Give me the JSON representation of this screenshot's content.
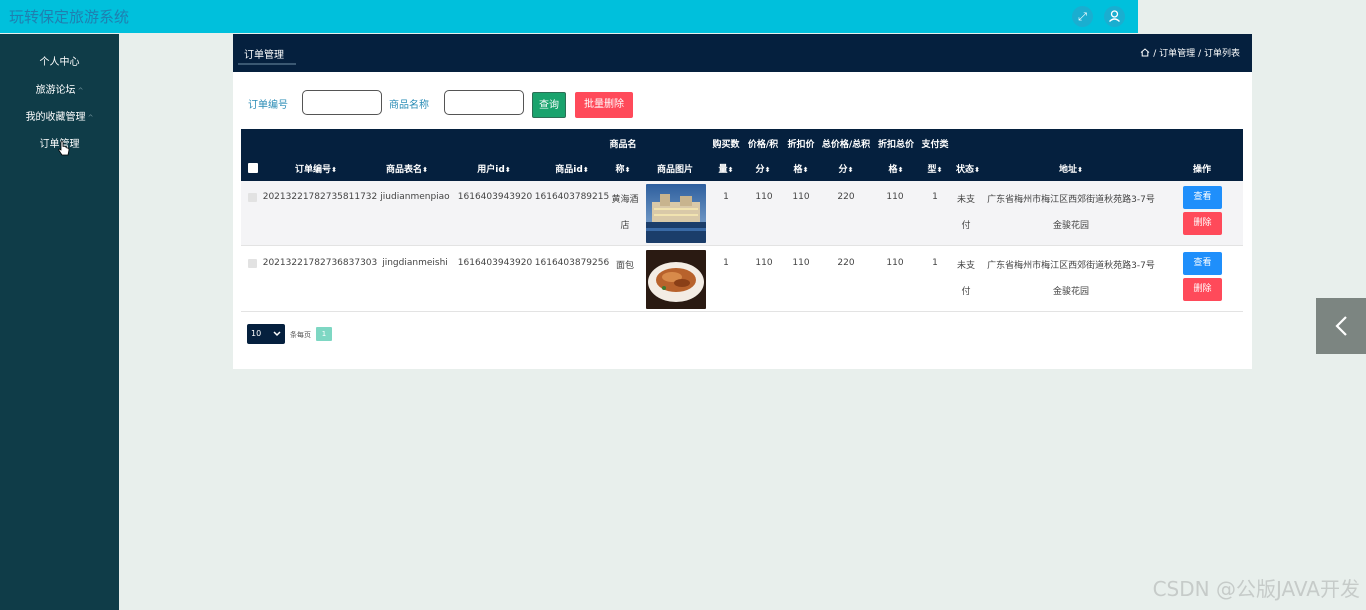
{
  "app": {
    "title": "玩转保定旅游系统"
  },
  "topbar": {
    "fullscreen_icon": "⤢",
    "user_icon": "👤"
  },
  "sidebar": {
    "items": [
      {
        "label": "个人中心",
        "caret": ""
      },
      {
        "label": "旅游论坛",
        "caret": "^"
      },
      {
        "label": "我的收藏管理",
        "caret": "^"
      },
      {
        "label": "订单管理",
        "caret": ""
      }
    ]
  },
  "panel": {
    "tab": "订单管理",
    "breadcrumb": {
      "current": "订单管理",
      "sub": "订单列表",
      "sep": "/"
    }
  },
  "filters": {
    "order_no_label": "订单编号",
    "order_no_value": "",
    "goods_name_label": "商品名称",
    "goods_name_value": "",
    "query_button": "查询",
    "bulk_delete_button": "批量删除"
  },
  "table": {
    "headers": {
      "order_no": "订单编号",
      "table_name": "商品表名",
      "user_id": "用户id",
      "goods_id": "商品id",
      "goods_name_1": "商品名",
      "goods_name_2": "称",
      "goods_image": "商品图片",
      "qty_1": "购买数",
      "qty_2": "量",
      "price_1": "价格/积",
      "price_2": "分",
      "discount_1": "折扣价",
      "discount_2": "格",
      "total_1": "总价格/总积",
      "total_2": "分",
      "discount_total_1": "折扣总价",
      "discount_total_2": "格",
      "pay_type_1": "支付类",
      "pay_type_2": "型",
      "status": "状态",
      "address": "地址",
      "actions": "操作",
      "sort": "⬍"
    },
    "rows": [
      {
        "order_no": "20213221782735811732",
        "table_name": "jiudianmenpiao",
        "user_id": "1616403943920",
        "goods_id": "1616403789215",
        "goods_name_1": "黄海酒",
        "goods_name_2": "店",
        "image_icon": "hotel-photo",
        "qty": "1",
        "price": "110",
        "discount": "110",
        "total": "220",
        "discount_total": "110",
        "pay_type": "1",
        "status_1": "未支",
        "status_2": "付",
        "address_1": "广东省梅州市梅江区西郊街道秋苑路3-7号",
        "address_2": "金骏花园",
        "view_label": "查看",
        "delete_label": "删除"
      },
      {
        "order_no": "20213221782736837303",
        "table_name": "jingdianmeishi",
        "user_id": "1616403943920",
        "goods_id": "1616403879256",
        "goods_name_1": "面包",
        "goods_name_2": "",
        "image_icon": "food-photo",
        "qty": "1",
        "price": "110",
        "discount": "110",
        "total": "220",
        "discount_total": "110",
        "pay_type": "1",
        "status_1": "未支",
        "status_2": "付",
        "address_1": "广东省梅州市梅江区西郊街道秋苑路3-7号",
        "address_2": "金骏花园",
        "view_label": "查看",
        "delete_label": "删除"
      }
    ]
  },
  "pager": {
    "page_size": "10",
    "per_page_label": "条每页",
    "current_page": "1"
  },
  "watermark": "CSDN @公版JAVA开发",
  "colors": {
    "topbar": "#00c0dc",
    "sidebar": "#0f3c48",
    "table_header": "#05203e",
    "view_btn": "#1f8ffb",
    "delete_btn": "#ff4a5a",
    "query_btn": "#1aa36d"
  }
}
